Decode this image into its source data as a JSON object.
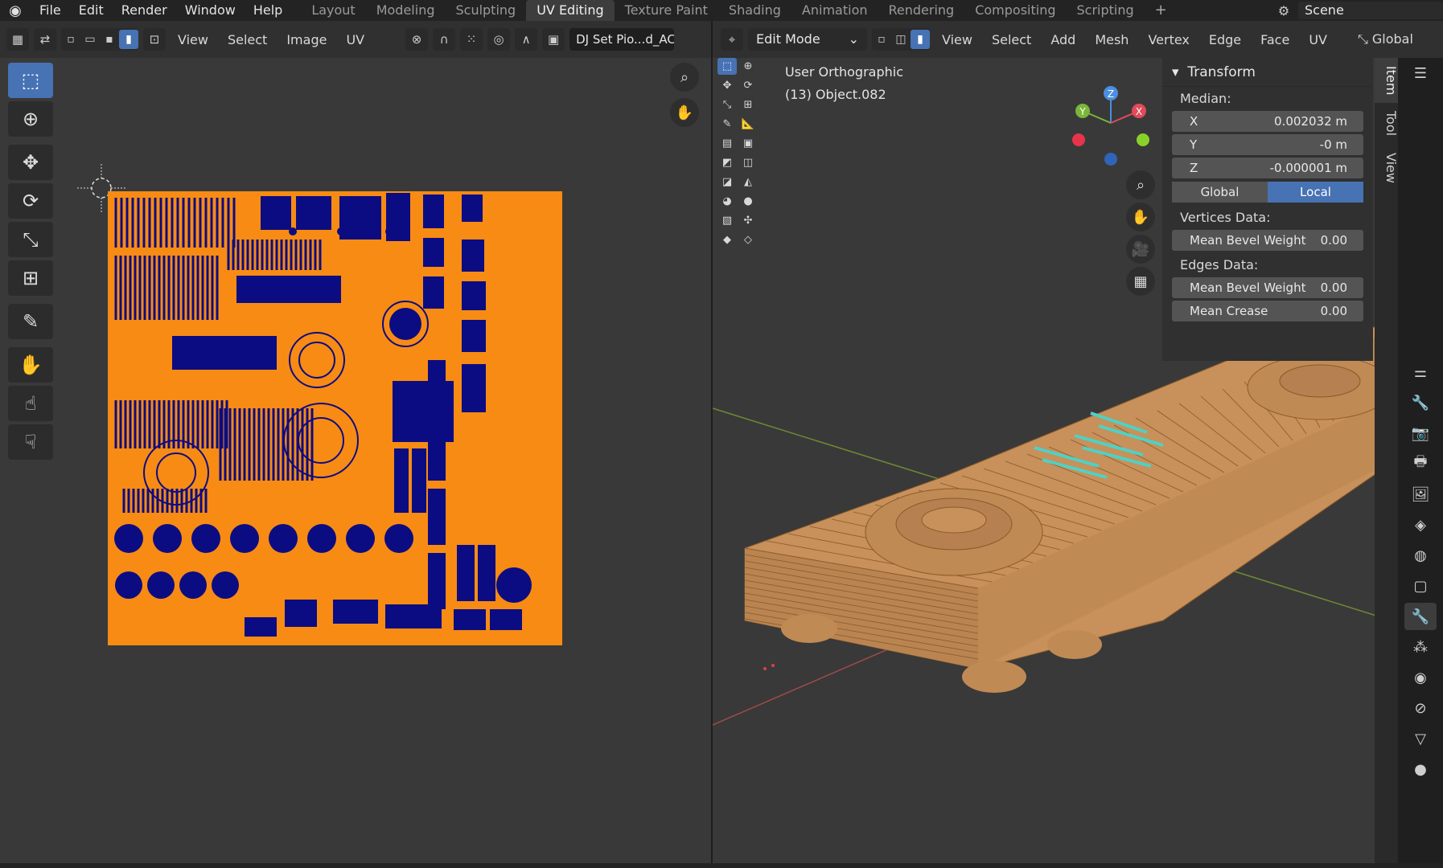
{
  "topbar": {
    "menus": [
      "File",
      "Edit",
      "Render",
      "Window",
      "Help"
    ],
    "workspaces": [
      "Layout",
      "Modeling",
      "Sculpting",
      "UV Editing",
      "Texture Paint",
      "Shading",
      "Animation",
      "Rendering",
      "Compositing",
      "Scripting"
    ],
    "active_workspace": "UV Editing",
    "scene_name": "Scene"
  },
  "uv_editor": {
    "menus": [
      "View",
      "Select",
      "Image",
      "UV"
    ],
    "image_name": "DJ Set Pio...d_AC"
  },
  "viewport": {
    "mode": "Edit Mode",
    "menus": [
      "View",
      "Select",
      "Add",
      "Mesh",
      "Vertex",
      "Edge",
      "Face",
      "UV"
    ],
    "orientation": "Global",
    "view_label": "User Orthographic",
    "object_label": "(13) Object.082",
    "gizmo": {
      "x": "X",
      "y": "Y",
      "z": "Z"
    }
  },
  "npanel": {
    "title": "Transform",
    "median_label": "Median:",
    "fields": [
      {
        "label": "X",
        "value": "0.002032 m"
      },
      {
        "label": "Y",
        "value": "-0 m"
      },
      {
        "label": "Z",
        "value": "-0.000001 m"
      }
    ],
    "toggle": [
      "Global",
      "Local"
    ],
    "toggle_active": "Local",
    "vertices_label": "Vertices Data:",
    "vertices_fields": [
      {
        "label": "Mean Bevel Weight",
        "value": "0.00"
      }
    ],
    "edges_label": "Edges Data:",
    "edges_fields": [
      {
        "label": "Mean Bevel Weight",
        "value": "0.00"
      },
      {
        "label": "Mean Crease",
        "value": "0.00"
      }
    ],
    "tabs": [
      "Item",
      "Tool",
      "View"
    ],
    "active_tab": "Item"
  },
  "colors": {
    "uv_orange": "#f78b14",
    "uv_island": "#0c0c82",
    "mesh_tan": "#c8905a",
    "selected_cyan": "#4fd1c5",
    "accent_blue": "#4772b3"
  }
}
